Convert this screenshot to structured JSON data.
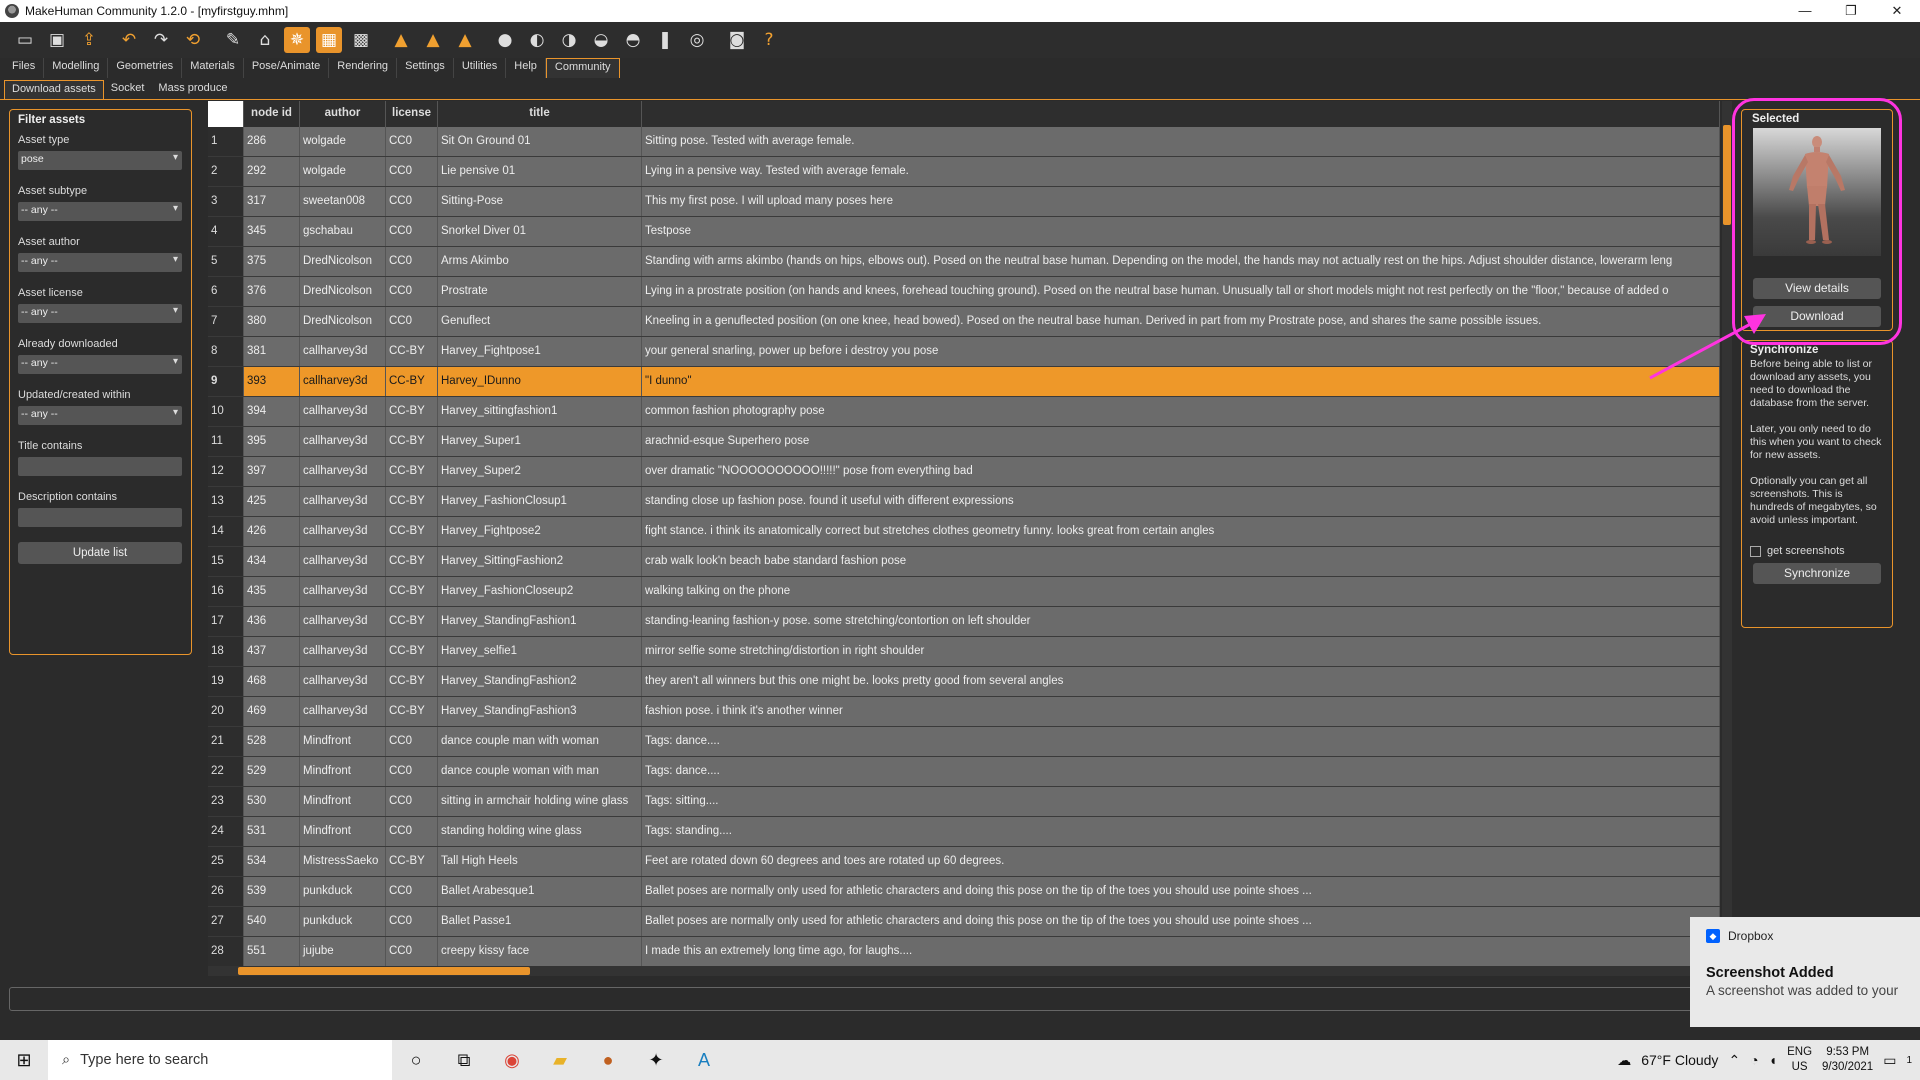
{
  "window": {
    "title": "MakeHuman Community 1.2.0 - [myfirstguy.mhm]",
    "controls": [
      "—",
      "❐",
      "✕"
    ]
  },
  "toolbar": {
    "icons": [
      "new-file",
      "save",
      "export",
      "undo",
      "redo",
      "reset",
      "smooth",
      "wireframe",
      "pose",
      "grid",
      "checker",
      "front-view",
      "back-view",
      "left-view",
      "head",
      "sphere1",
      "sphere2",
      "sphere3",
      "sphere4",
      "feet",
      "frame",
      "camera",
      "help"
    ]
  },
  "menu": {
    "tabs": [
      "Files",
      "Modelling",
      "Geometries",
      "Materials",
      "Pose/Animate",
      "Rendering",
      "Settings",
      "Utilities",
      "Help",
      "Community"
    ],
    "active": "Community"
  },
  "subtabs": {
    "items": [
      "Download assets",
      "Socket",
      "Mass produce"
    ],
    "active": "Download assets"
  },
  "filter": {
    "title": "Filter assets",
    "asset_type_label": "Asset type",
    "asset_type_value": "pose",
    "asset_subtype_label": "Asset subtype",
    "asset_subtype_value": "-- any --",
    "asset_author_label": "Asset author",
    "asset_author_value": "-- any --",
    "asset_license_label": "Asset license",
    "asset_license_value": "-- any --",
    "already_downloaded_label": "Already downloaded",
    "already_downloaded_value": "-- any --",
    "updated_within_label": "Updated/created within",
    "updated_within_value": "-- any --",
    "title_contains_label": "Title contains",
    "title_contains_value": "",
    "description_contains_label": "Description contains",
    "description_contains_value": "",
    "update_button": "Update list"
  },
  "table": {
    "columns": [
      "",
      "node id",
      "author",
      "license",
      "title",
      ""
    ],
    "selected_row": 9,
    "rows": [
      [
        "1",
        "286",
        "wolgade",
        "CC0",
        "Sit On Ground 01",
        "Sitting pose. Tested with average female."
      ],
      [
        "2",
        "292",
        "wolgade",
        "CC0",
        "Lie pensive 01",
        "Lying in a pensive way. Tested with average female."
      ],
      [
        "3",
        "317",
        "sweetan008",
        "CC0",
        "Sitting-Pose",
        "This my first pose. I will upload many poses here"
      ],
      [
        "4",
        "345",
        "gschabau",
        "CC0",
        "Snorkel Diver 01",
        "Testpose"
      ],
      [
        "5",
        "375",
        "DredNicolson",
        "CC0",
        "Arms Akimbo",
        "Standing with arms akimbo (hands on hips, elbows out). Posed on the neutral base human. Depending on the model, the hands may not actually rest on the hips. Adjust shoulder distance, lowerarm leng"
      ],
      [
        "6",
        "376",
        "DredNicolson",
        "CC0",
        "Prostrate",
        "Lying in a prostrate position (on hands and knees, forehead touching ground). Posed on the neutral base human. Unusually tall or short models might not rest perfectly on the \"floor,\" because of added o"
      ],
      [
        "7",
        "380",
        "DredNicolson",
        "CC0",
        "Genuflect",
        "Kneeling in a genuflected position (on one knee, head bowed). Posed on the neutral base human. Derived in part from my Prostrate pose, and shares the same possible issues."
      ],
      [
        "8",
        "381",
        "callharvey3d",
        "CC-BY",
        "Harvey_Fightpose1",
        "your general snarling, power up before i destroy you pose"
      ],
      [
        "9",
        "393",
        "callharvey3d",
        "CC-BY",
        "Harvey_IDunno",
        "\"I dunno\""
      ],
      [
        "10",
        "394",
        "callharvey3d",
        "CC-BY",
        "Harvey_sittingfashion1",
        "common fashion photography pose"
      ],
      [
        "11",
        "395",
        "callharvey3d",
        "CC-BY",
        "Harvey_Super1",
        "arachnid-esque Superhero pose"
      ],
      [
        "12",
        "397",
        "callharvey3d",
        "CC-BY",
        "Harvey_Super2",
        "over dramatic \"NOOOOOOOOOO!!!!!\"  pose from everything bad"
      ],
      [
        "13",
        "425",
        "callharvey3d",
        "CC-BY",
        "Harvey_FashionClosup1",
        "standing close up fashion pose.  found it useful with different expressions"
      ],
      [
        "14",
        "426",
        "callharvey3d",
        "CC-BY",
        "Harvey_Fightpose2",
        "fight stance.  i think its anatomically correct but stretches clothes geometry funny.  looks great from certain angles"
      ],
      [
        "15",
        "434",
        "callharvey3d",
        "CC-BY",
        "Harvey_SittingFashion2",
        "crab walk look'n beach babe standard fashion pose"
      ],
      [
        "16",
        "435",
        "callharvey3d",
        "CC-BY",
        "Harvey_FashionCloseup2",
        "walking talking on the phone"
      ],
      [
        "17",
        "436",
        "callharvey3d",
        "CC-BY",
        "Harvey_StandingFashion1",
        "standing-leaning fashion-y pose.  some stretching/contortion on left shoulder"
      ],
      [
        "18",
        "437",
        "callharvey3d",
        "CC-BY",
        "Harvey_selfie1",
        "mirror selfie      some stretching/distortion in right shoulder"
      ],
      [
        "19",
        "468",
        "callharvey3d",
        "CC-BY",
        "Harvey_StandingFashion2",
        "they aren't all winners but this one might be.  looks pretty good from several angles"
      ],
      [
        "20",
        "469",
        "callharvey3d",
        "CC-BY",
        "Harvey_StandingFashion3",
        "fashion pose.  i think it's another winner"
      ],
      [
        "21",
        "528",
        "Mindfront",
        "CC0",
        "dance couple man with woman",
        "Tags: dance...."
      ],
      [
        "22",
        "529",
        "Mindfront",
        "CC0",
        "dance couple woman with man",
        "Tags: dance...."
      ],
      [
        "23",
        "530",
        "Mindfront",
        "CC0",
        "sitting in armchair holding wine glass",
        "Tags: sitting...."
      ],
      [
        "24",
        "531",
        "Mindfront",
        "CC0",
        "standing holding wine glass",
        "Tags: standing...."
      ],
      [
        "25",
        "534",
        "MistressSaeko",
        "CC-BY",
        "Tall High Heels",
        "Feet are rotated down 60 degrees and toes are rotated up 60 degrees."
      ],
      [
        "26",
        "539",
        "punkduck",
        "CC0",
        "Ballet Arabesque1",
        "Ballet poses are normally only used for athletic characters and doing this pose on the tip of the toes you should use pointe shoes ..."
      ],
      [
        "27",
        "540",
        "punkduck",
        "CC0",
        "Ballet Passe1",
        "Ballet poses are normally only used for athletic characters and doing this pose on the tip of the toes you should use pointe shoes ..."
      ],
      [
        "28",
        "551",
        "jujube",
        "CC0",
        "creepy kissy face",
        "I made this an extremely long time ago, for laughs...."
      ]
    ]
  },
  "selected_panel": {
    "title": "Selected",
    "view_details": "View details",
    "download": "Download"
  },
  "sync_panel": {
    "title": "Synchronize",
    "text1": "Before being able to list or download any assets, you need to download the database from the server.",
    "text2": "Later, you only need to do this when you want to check for new assets.",
    "text3": "Optionally you can get all screenshots. This is hundreds of megabytes, so avoid unless important.",
    "checkbox_label": "get screenshots",
    "sync_button": "Synchronize"
  },
  "notification": {
    "app": "Dropbox",
    "title": "Screenshot Added",
    "body": "A screenshot was added to your"
  },
  "taskbar": {
    "search_placeholder": "Type here to search",
    "weather": "67°F  Cloudy",
    "lang1": "ENG",
    "lang2": "US",
    "time": "9:53 PM",
    "date": "9/30/2021",
    "notif_count": "1"
  },
  "colors": {
    "accent": "#e9942b",
    "highlight": "#ff33e0",
    "row_bg": "#6b6b6b",
    "selected_row": "#ee9829"
  }
}
